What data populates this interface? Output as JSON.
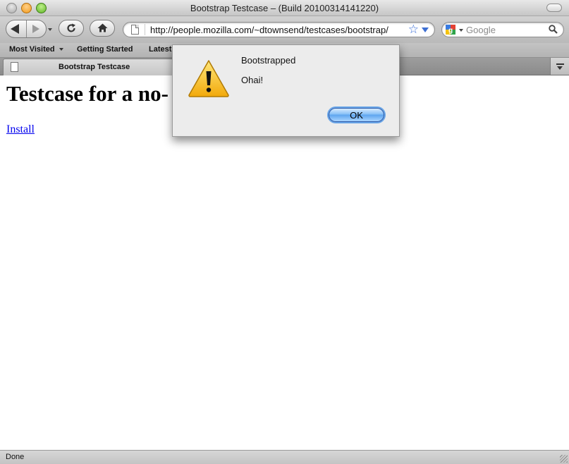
{
  "window": {
    "title": "Bootstrap Testcase – (Build 20100314141220)"
  },
  "toolbar": {
    "url": "http://people.mozilla.com/~dtownsend/testcases/bootstrap/",
    "search_placeholder": "Google"
  },
  "bookmarks": [
    {
      "label": "Most Visited"
    },
    {
      "label": "Getting Started"
    },
    {
      "label": "Latest"
    }
  ],
  "tabs": [
    {
      "label": "Bootstrap Testcase"
    }
  ],
  "page": {
    "heading": "Testcase for a no-",
    "link": "Install"
  },
  "status": "Done",
  "dialog": {
    "title": "Bootstrapped",
    "message": "Ohai!",
    "ok_label": "OK"
  },
  "colors": {
    "link": "#0000ee",
    "ok_button": "#86bff6",
    "warning_icon": "#f7c614"
  }
}
